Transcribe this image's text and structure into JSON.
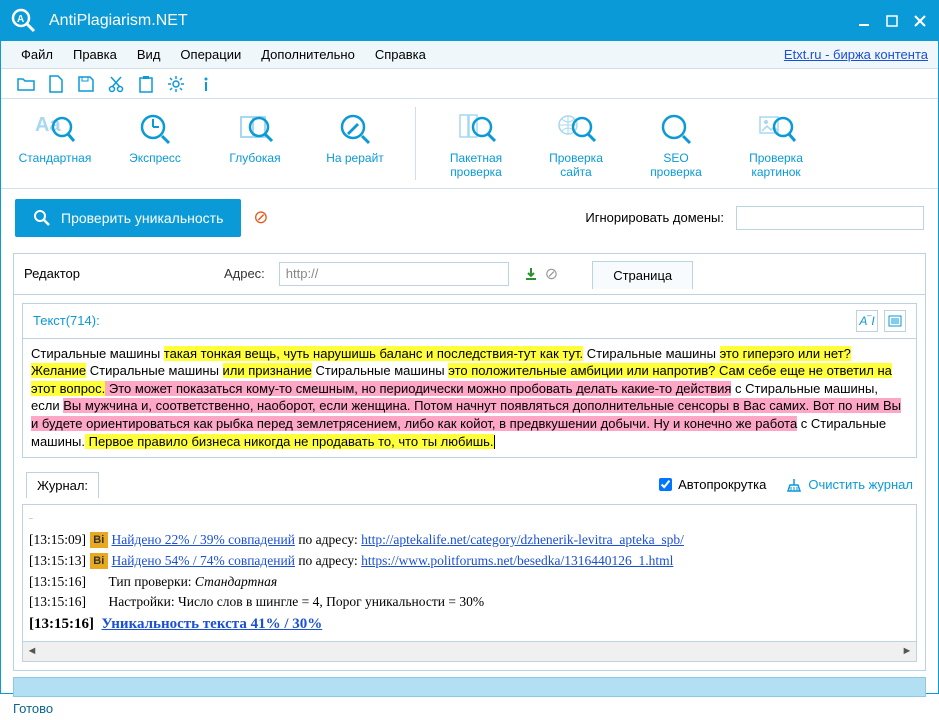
{
  "window": {
    "title": "AntiPlagiarism.NET"
  },
  "menubar": {
    "items": [
      "Файл",
      "Правка",
      "Вид",
      "Операции",
      "Дополнительно",
      "Справка"
    ],
    "link": "Etxt.ru - биржа контента"
  },
  "toolbar": {
    "standard": "Стандартная",
    "express": "Экспресс",
    "deep": "Глубокая",
    "rewrite": "На рерайт",
    "batch": "Пакетная проверка",
    "site": "Проверка сайта",
    "seo": "SEO проверка",
    "images": "Проверка картинок"
  },
  "action": {
    "check_label": "Проверить уникальность",
    "ignore_label": "Игнорировать домены:"
  },
  "editor": {
    "label": "Редактор",
    "addr_label": "Адрес:",
    "addr_value": "http://",
    "page_tab": "Страница",
    "text_label": "Текст(714):"
  },
  "text": {
    "p1a": "Стиральные машины ",
    "p1b": "такая тонкая вещь, чуть нарушишь баланс и последствия-тут как тут.",
    "p1c": " Стиральные машины ",
    "p1d": "это гиперэго или нет? Желание",
    "p2a": " Стиральные машины ",
    "p2b": "или признание",
    "p2c": " Стиральные машины ",
    "p2d": "это положительные амбиции или напротив? Сам себе еще не ответил на этот вопрос.",
    "p3a": " Это может показаться кому-то смешным, но периодически можно пробовать делать какие-то действия",
    "p3b": " с Стиральные машины, если ",
    "p3c": "Вы мужчина и, соответственно, наоборот, если женщина. Потом начнут появляться дополнительные сенсоры в Вас самих. Вот по ним Вы и будете ориентироваться как рыбка перед землетрясением, либо как койот, в предвкушении добычи. Ну и конечно же работа",
    "p3d": " с Стиральные машины.",
    "p4a": " Первое правило бизнеса никогда не продавать то, что ты любишь."
  },
  "journal": {
    "label": "Журнал:",
    "autoscroll": "Автопрокрутка",
    "clear": "Очистить журнал",
    "rows": [
      {
        "time": "[13:15:09]",
        "badge": "Bi",
        "found": "Найдено 22% / 39% совпадений",
        "mid": " по адресу: ",
        "url": "http://aptekalife.net/category/dzhenerik-levitra_apteka_spb/"
      },
      {
        "time": "[13:15:13]",
        "badge": "Bi",
        "found": "Найдено 54% / 74% совпадений",
        "mid": " по адресу: ",
        "url": "https://www.politforums.net/besedka/1316440126_1.html"
      },
      {
        "time": "[13:15:16]",
        "plain_a": "Тип проверки: ",
        "plain_b": "Стандартная"
      },
      {
        "time": "[13:15:16]",
        "plain_a": "Настройки: Число слов в шингле = 4, Порог уникальности = 30%"
      },
      {
        "time": "[13:15:16]",
        "result": "Уникальность текста 41% / 30%"
      }
    ]
  },
  "status": "Готово"
}
